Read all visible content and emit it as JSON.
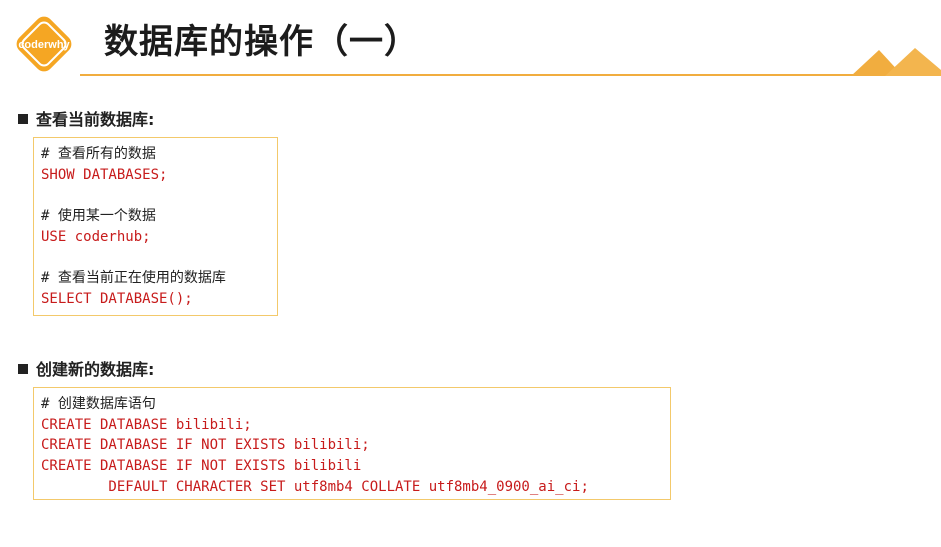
{
  "header": {
    "logo_text": "coderwhy",
    "title": "数据库的操作（一）"
  },
  "colors": {
    "accent": "#f1ad3f",
    "code_border": "#f3c96b",
    "sql_text": "#c71b1b",
    "comment_text": "#222222"
  },
  "sections": [
    {
      "heading": "查看当前数据库:",
      "lines": [
        {
          "type": "comment",
          "text": "# 查看所有的数据"
        },
        {
          "type": "sql",
          "text": "SHOW DATABASES;"
        },
        {
          "type": "blank",
          "text": ""
        },
        {
          "type": "comment",
          "text": "# 使用某一个数据"
        },
        {
          "type": "sql",
          "text": "USE coderhub;"
        },
        {
          "type": "blank",
          "text": ""
        },
        {
          "type": "comment",
          "text": "# 查看当前正在使用的数据库"
        },
        {
          "type": "sql",
          "text": "SELECT DATABASE();"
        }
      ]
    },
    {
      "heading": "创建新的数据库:",
      "lines": [
        {
          "type": "comment",
          "text": "# 创建数据库语句"
        },
        {
          "type": "sql",
          "text": "CREATE DATABASE bilibili;"
        },
        {
          "type": "sql",
          "text": "CREATE DATABASE IF NOT EXISTS bilibili;"
        },
        {
          "type": "sql",
          "text": "CREATE DATABASE IF NOT EXISTS bilibili"
        },
        {
          "type": "sql",
          "text": "        DEFAULT CHARACTER SET utf8mb4 COLLATE utf8mb4_0900_ai_ci;"
        }
      ]
    }
  ]
}
